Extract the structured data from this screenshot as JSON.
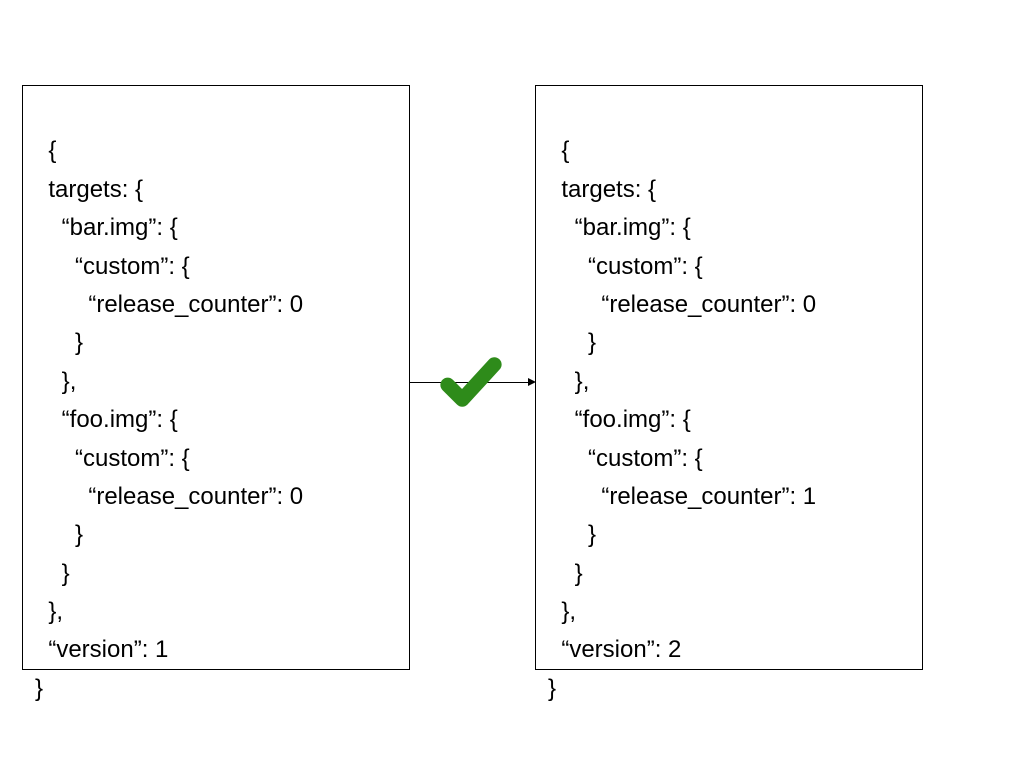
{
  "left_box": {
    "lines": [
      "{",
      "  targets: {",
      "    “bar.img”: {",
      "      “custom”: {",
      "        “release_counter”: 0",
      "      }",
      "    },",
      "    “foo.img”: {",
      "      “custom”: {",
      "        “release_counter”: 0",
      "      }",
      "    }",
      "  },",
      "  “version”: 1",
      "}"
    ]
  },
  "right_box": {
    "lines": [
      "{",
      "  targets: {",
      "    “bar.img”: {",
      "      “custom”: {",
      "        “release_counter”: 0",
      "      }",
      "    },",
      "    “foo.img”: {",
      "      “custom”: {",
      "        “release_counter”: 1",
      "      }",
      "    }",
      "  },",
      "  “version”: 2",
      "}"
    ]
  },
  "checkmark_color": "#2e8b1a"
}
